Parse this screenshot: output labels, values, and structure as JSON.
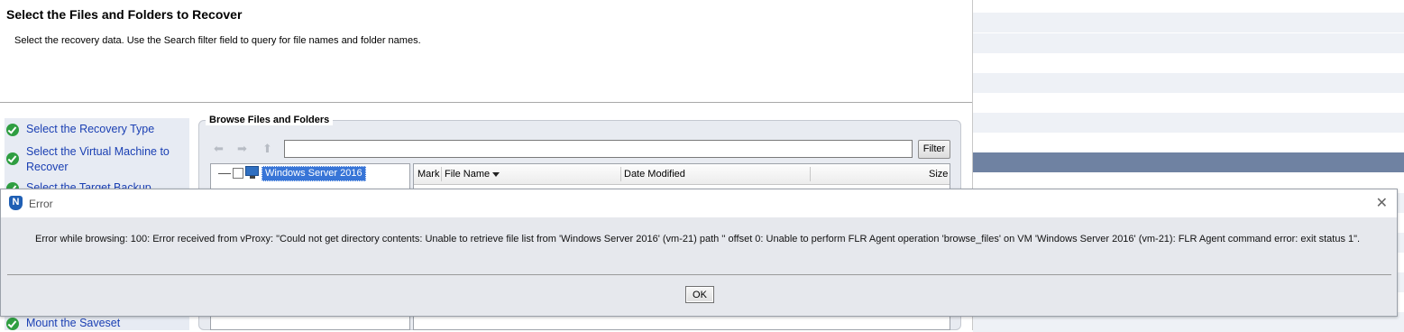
{
  "wizard": {
    "title": "Select the Files and Folders to Recover",
    "description": "Select the recovery data. Use the Search filter field to query for file names and folder names."
  },
  "steps": [
    {
      "label": "Select the Recovery Type"
    },
    {
      "label": "Select the Virtual Machine to Recover"
    },
    {
      "label": "Select the Target Backup"
    },
    {
      "label": "Mount the Saveset"
    }
  ],
  "browse": {
    "legend": "Browse Files and Folders",
    "path_value": "",
    "filter_label": "Filter",
    "tree_root": "Windows Server 2016",
    "columns": {
      "mark": "Mark",
      "file_name": "File Name",
      "date_modified": "Date Modified",
      "size": "Size"
    }
  },
  "dialog": {
    "title": "Error",
    "message": "Error while browsing: 100: Error received from vProxy: \"Could not get directory contents: Unable to retrieve file list from 'Windows Server 2016' (vm-21) path '' offset 0:  Unable to perform FLR Agent operation 'browse_files' on VM 'Windows Server 2016' (vm-21): FLR Agent command error: exit status 1\".",
    "ok_label": "OK",
    "close_glyph": "✕"
  },
  "icons": {
    "back": "back-arrow-icon",
    "forward": "forward-arrow-icon",
    "up": "up-arrow-icon",
    "step_done": "green-check-icon",
    "vm": "monitor-icon",
    "logo": "networker-logo-icon"
  },
  "colors": {
    "step_link": "#1a3fb3",
    "check_green": "#2f9e41",
    "selection": "#3875d7",
    "row_highlight": "#6f82a2"
  }
}
